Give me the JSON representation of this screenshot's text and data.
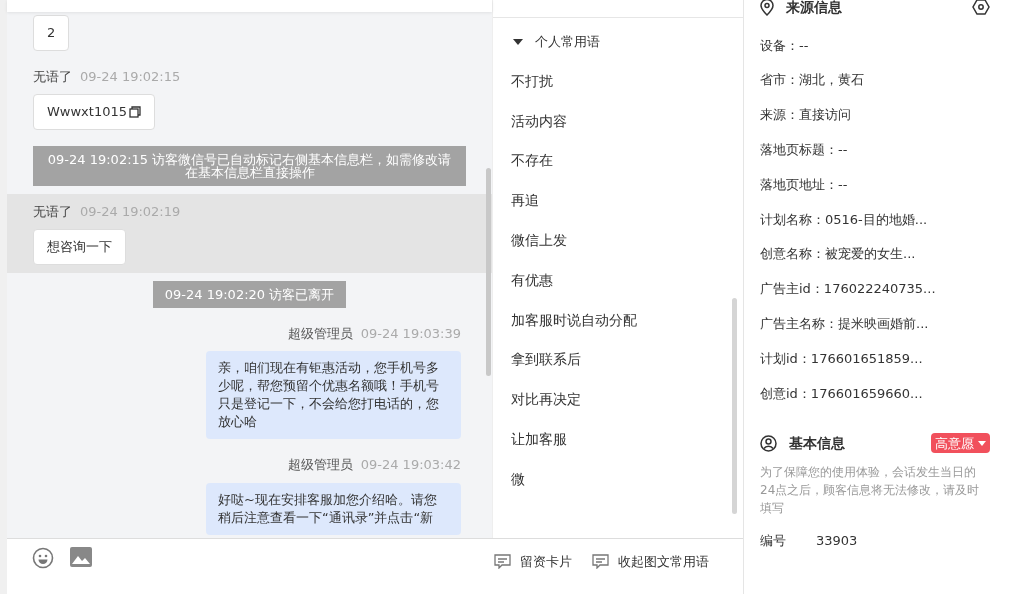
{
  "chat": {
    "messages": [
      {
        "kind": "visitor",
        "text": "2",
        "highlighted": false
      },
      {
        "kind": "visitor",
        "sender": "无语了",
        "time": "09-24 19:02:15",
        "text": "Wwwxt1015",
        "copyable": true,
        "highlighted": false
      },
      {
        "kind": "system",
        "text": "09-24 19:02:15 访客微信号已自动标记右侧基本信息栏，如需修改请在基本信息栏直接操作"
      },
      {
        "kind": "visitor",
        "sender": "无语了",
        "time": "09-24 19:02:19",
        "text": "想咨询一下",
        "highlighted": true
      },
      {
        "kind": "system",
        "text": "09-24 19:02:20 访客已离开"
      },
      {
        "kind": "agent",
        "sender": "超级管理员",
        "time": "09-24 19:03:39",
        "text": "亲，咱们现在有钜惠活动，您手机号多少呢，帮您预留个优惠名额哦！手机号只是登记一下，不会给您打电话的，您放心哈"
      },
      {
        "kind": "agent",
        "sender": "超级管理员",
        "time": "09-24 19:03:42",
        "text": "好哒~现在安排客服加您介绍哈。请您稍后注意查看一下“通讯录”并点击“新"
      }
    ]
  },
  "toolbar": {
    "tools": [
      {
        "kind": "emoji"
      },
      {
        "kind": "image"
      }
    ],
    "actions": [
      "留资卡片",
      "收起图文常用语"
    ]
  },
  "phrases": {
    "title": "个人常用语",
    "expanded": true,
    "items": [
      "不打扰",
      "活动内容",
      "不存在",
      "再追",
      "微信上发",
      "有优惠",
      "加客服时说自动分配",
      "拿到联系后",
      "对比再决定",
      "让加客服",
      "微"
    ]
  },
  "source_info": {
    "title": "来源信息",
    "rows": [
      "设备：--",
      "省市：湖北，黄石",
      "来源：直接访问",
      "落地页标题：--",
      "落地页地址：--",
      "计划名称：0516-目的地婚...",
      "创意名称：被宠爱的女生...",
      "广告主id：176022240735...",
      "广告主名称：提米映画婚前...",
      "计划id：176601651859...",
      "创意id：176601659660..."
    ]
  },
  "basic_info": {
    "title": "基本信息",
    "intent_badge": "高意愿",
    "note": "为了保障您的使用体验，会话发生当日的24点之后，顾客信息将无法修改，请及时填写",
    "fields": [
      {
        "label": "编号",
        "value": "33903"
      }
    ]
  }
}
